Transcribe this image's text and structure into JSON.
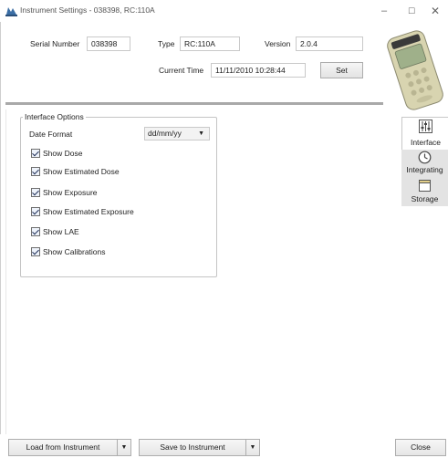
{
  "window": {
    "title": "Instrument Settings - 038398, RC:110A",
    "controls": {
      "minimize": "–",
      "maximize": "☐",
      "close": "✕"
    }
  },
  "header": {
    "serial_label": "Serial Number",
    "serial_value": "038398",
    "type_label": "Type",
    "type_value": "RC:110A",
    "version_label": "Version",
    "version_value": "2.0.4",
    "current_time_label": "Current Time",
    "current_time_value": "11/11/2010 10:28:44",
    "set_label": "Set"
  },
  "interface_options": {
    "group_title": "Interface Options",
    "date_format_label": "Date Format",
    "date_format_value": "dd/mm/yy",
    "checkboxes": [
      {
        "label": "Show Dose",
        "checked": true
      },
      {
        "label": "Show Estimated Dose",
        "checked": true
      },
      {
        "label": "Show Exposure",
        "checked": true
      },
      {
        "label": "Show Estimated Exposure",
        "checked": true
      },
      {
        "label": "Show LAE",
        "checked": true
      },
      {
        "label": "Show Calibrations",
        "checked": true
      }
    ]
  },
  "tabs": [
    {
      "label": "Interface",
      "icon": "interface-sliders-icon",
      "active": true
    },
    {
      "label": "Integrating",
      "icon": "clock-icon",
      "active": false
    },
    {
      "label": "Storage",
      "icon": "storage-card-icon",
      "active": false
    }
  ],
  "footer": {
    "load_label": "Load from Instrument",
    "save_label": "Save to Instrument",
    "close_label": "Close"
  },
  "colors": {
    "active_tab": "#ffffff",
    "inactive_tab": "#e3e3e3",
    "device_body": "#d8d4b0"
  }
}
